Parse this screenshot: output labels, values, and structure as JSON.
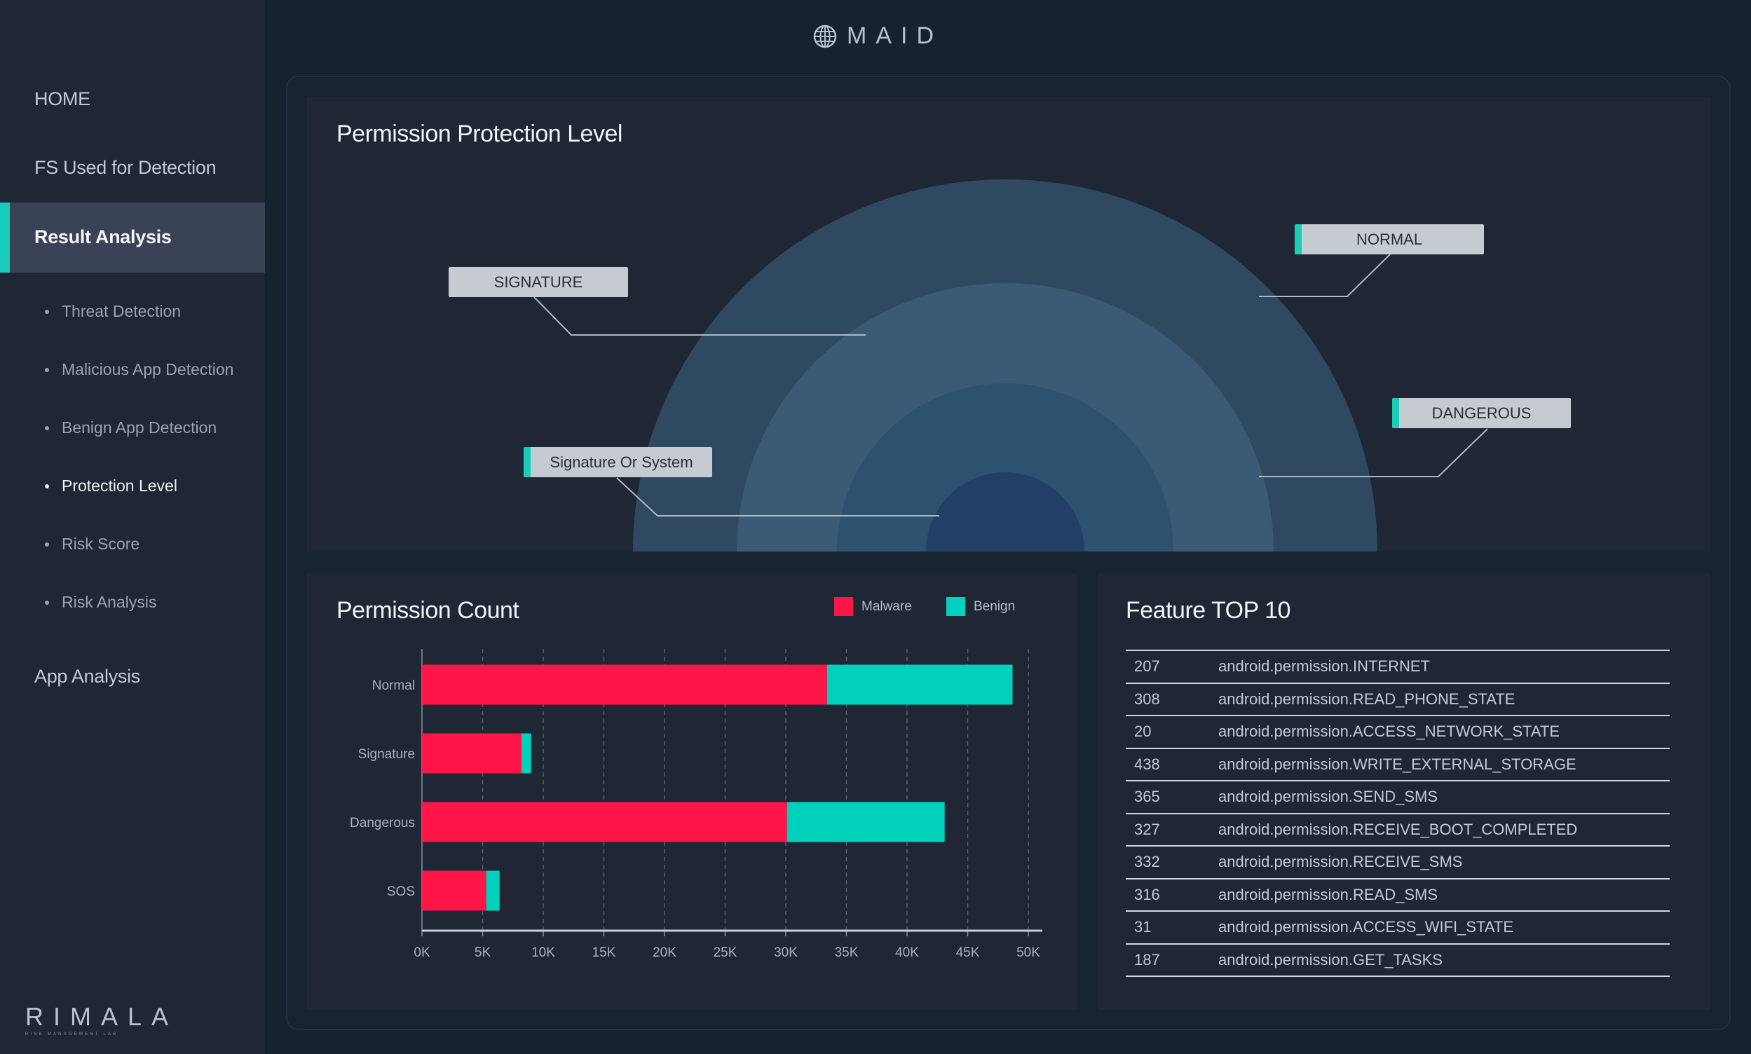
{
  "app": {
    "title": "MAID",
    "logo_icon": "globe-icon"
  },
  "sidebar": {
    "items": [
      {
        "label": "HOME",
        "active": false
      },
      {
        "label": "FS Used for Detection",
        "active": false
      },
      {
        "label": "Result Analysis",
        "active": true
      },
      {
        "label": "App Analysis",
        "active": false
      }
    ],
    "sub_items": [
      {
        "label": "Threat Detection",
        "active": false
      },
      {
        "label": "Malicious App Detection",
        "active": false
      },
      {
        "label": "Benign App Detection",
        "active": false
      },
      {
        "label": "Protection Level",
        "active": true
      },
      {
        "label": "Risk Score",
        "active": false
      },
      {
        "label": "Risk Analysis",
        "active": false
      }
    ],
    "brand": {
      "name": "RIMALA",
      "tagline": "RISK MANAGEMENT LAB"
    }
  },
  "colors": {
    "accent": "#19cdb9",
    "malware": "#ff1648",
    "benign": "#00d1bc"
  },
  "protection_panel": {
    "title": "Permission Protection Level",
    "levels": [
      {
        "label": "NORMAL",
        "accent": true,
        "ring_color": "#2f4a60"
      },
      {
        "label": "SIGNATURE",
        "accent": false,
        "ring_color": "#3a5a75"
      },
      {
        "label": "DANGEROUS",
        "accent": true,
        "ring_color": "#2c5270"
      },
      {
        "label": "Signature Or System",
        "accent": true,
        "ring_color": "#223f66"
      }
    ]
  },
  "chart_data": {
    "type": "bar",
    "orientation": "horizontal",
    "stacked": true,
    "title": "Permission Count",
    "categories": [
      "Normal",
      "Signature",
      "Dangerous",
      "SOS"
    ],
    "series": [
      {
        "name": "Malware",
        "color": "#ff1648",
        "values": [
          33400,
          8200,
          30100,
          5300
        ]
      },
      {
        "name": "Benign",
        "color": "#00d1bc",
        "values": [
          15300,
          800,
          13000,
          1100
        ]
      }
    ],
    "xlim": [
      0,
      50000
    ],
    "xticks": [
      "0K",
      "5K",
      "10K",
      "15K",
      "20K",
      "25K",
      "30K",
      "35K",
      "40K",
      "45K",
      "50K"
    ],
    "xlabel": "",
    "ylabel": "",
    "grid": "vertical-dashed",
    "legend": "top-right"
  },
  "feature_panel": {
    "title": "Feature TOP 10",
    "rows": [
      {
        "id": "207",
        "permission": "android.permission.INTERNET"
      },
      {
        "id": "308",
        "permission": "android.permission.READ_PHONE_STATE"
      },
      {
        "id": "20",
        "permission": "android.permission.ACCESS_NETWORK_STATE"
      },
      {
        "id": "438",
        "permission": "android.permission.WRITE_EXTERNAL_STORAGE"
      },
      {
        "id": "365",
        "permission": "android.permission.SEND_SMS"
      },
      {
        "id": "327",
        "permission": "android.permission.RECEIVE_BOOT_COMPLETED"
      },
      {
        "id": "332",
        "permission": "android.permission.RECEIVE_SMS"
      },
      {
        "id": "316",
        "permission": "android.permission.READ_SMS"
      },
      {
        "id": "31",
        "permission": "android.permission.ACCESS_WIFI_STATE"
      },
      {
        "id": "187",
        "permission": "android.permission.GET_TASKS"
      }
    ]
  }
}
